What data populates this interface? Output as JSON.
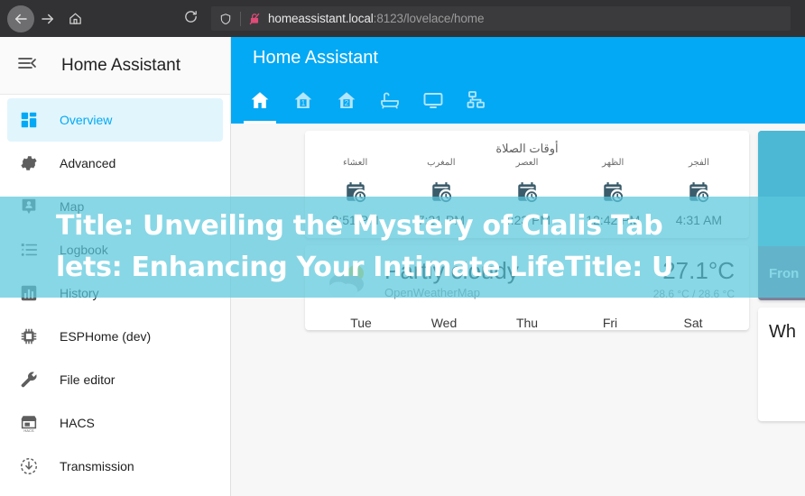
{
  "browser": {
    "back_icon": "arrow-left-icon",
    "forward_icon": "arrow-right-icon",
    "home_icon": "home-icon",
    "reload_icon": "reload-icon",
    "shield_icon": "shield-icon",
    "insecure_icon": "broken-lock-icon",
    "url_host": "homeassistant.local",
    "url_rest": ":8123/lovelace/home"
  },
  "sidebar": {
    "menu_icon": "hamburger-collapse-icon",
    "title": "Home Assistant",
    "items": [
      {
        "label": "Overview",
        "icon": "view-dashboard-icon",
        "active": true
      },
      {
        "label": "Advanced",
        "icon": "cog-icon",
        "active": false
      },
      {
        "label": "Map",
        "icon": "map-marker-icon",
        "active": false
      },
      {
        "label": "Logbook",
        "icon": "format-list-icon",
        "active": false
      },
      {
        "label": "History",
        "icon": "chart-box-icon",
        "active": false
      },
      {
        "label": "ESPHome (dev)",
        "icon": "chip-icon",
        "active": false
      },
      {
        "label": "File editor",
        "icon": "wrench-icon",
        "active": false
      },
      {
        "label": "HACS",
        "icon": "hacs-store-icon",
        "active": false
      },
      {
        "label": "Transmission",
        "icon": "download-circle-icon",
        "active": false
      }
    ]
  },
  "main": {
    "title": "Home Assistant",
    "accent_color": "#03a9f4",
    "tabs": [
      {
        "icon": "home-icon",
        "active": true
      },
      {
        "icon": "home-floor-1-icon",
        "active": false
      },
      {
        "icon": "home-floor-2-icon",
        "active": false
      },
      {
        "icon": "bathtub-icon",
        "active": false
      },
      {
        "icon": "monitor-icon",
        "active": false
      },
      {
        "icon": "lan-network-icon",
        "active": false
      }
    ]
  },
  "prayer_card": {
    "title": "أوقات الصلاة",
    "icon": "calendar-clock-icon",
    "entries": [
      {
        "name": "العشاء",
        "time": "8:51 PM"
      },
      {
        "name": "المغرب",
        "time": "7:21 PM"
      },
      {
        "name": "العصر",
        "time": "4:23 PM"
      },
      {
        "name": "الظهر",
        "time": "12:42 PM"
      },
      {
        "name": "الفجر",
        "time": "4:31 AM"
      }
    ]
  },
  "weather_card": {
    "icon": "partly-cloudy-icon",
    "condition": "Partly cloudy",
    "source": "OpenWeatherMap",
    "temperature": "27.1°C",
    "high_low": "28.6 °C / 28.6 °C",
    "days": [
      "Tue",
      "Wed",
      "Thu",
      "Fri",
      "Sat"
    ]
  },
  "camera_card": {
    "name": "Fron",
    "image_color": "#4cb8d4",
    "footer_color": "#7c8299"
  },
  "info_card": {
    "text": "Wh"
  },
  "overlay": {
    "line1": "Title: Unveiling the Mystery of Cialis Tab",
    "line2": "lets: Enhancing Your Intimate LifeTitle: U",
    "band_color": "#5ac8dc"
  }
}
